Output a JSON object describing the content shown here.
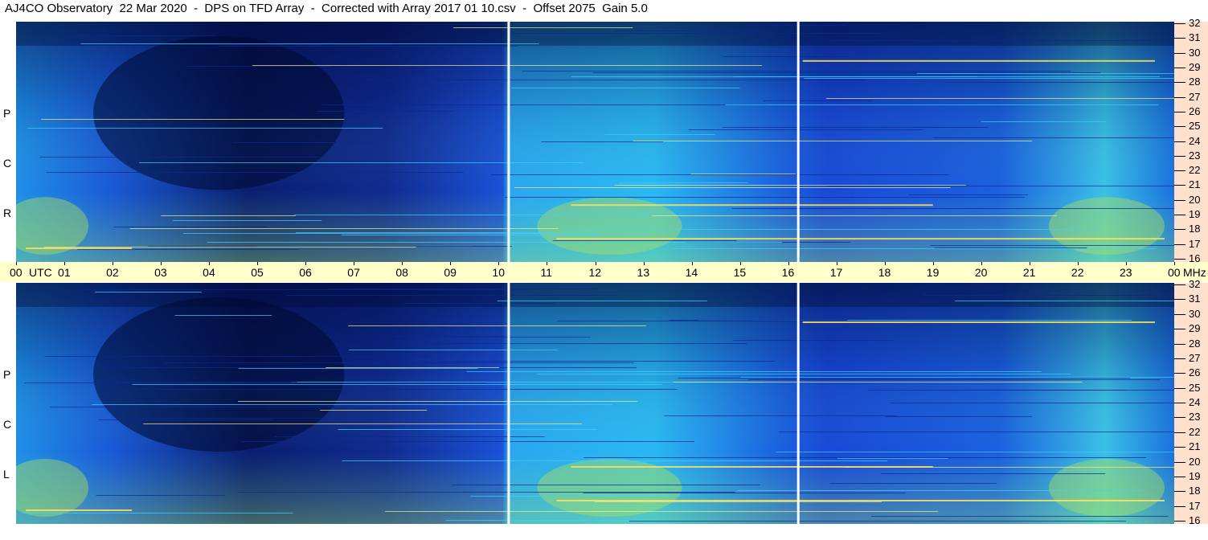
{
  "title": "AJ4CO Observatory  22 Mar 2020  -  DPS on TFD Array  -  Corrected with Array 2017 01 10.csv  -  Offset 2075  Gain 5.0",
  "panels": {
    "top": {
      "label_letters": [
        "P",
        "C",
        "R"
      ]
    },
    "bottom": {
      "label_letters": [
        "P",
        "C",
        "L"
      ]
    }
  },
  "time_axis": {
    "ticks": [
      "00",
      "01",
      "02",
      "03",
      "04",
      "05",
      "06",
      "07",
      "08",
      "09",
      "10",
      "11",
      "12",
      "13",
      "14",
      "15",
      "16",
      "17",
      "18",
      "19",
      "20",
      "21",
      "22",
      "23",
      "00"
    ],
    "unit_label": "UTC",
    "freq_unit_label": "MHz"
  },
  "freq_axis": {
    "ticks": [
      "32",
      "31",
      "30",
      "29",
      "28",
      "27",
      "26",
      "25",
      "24",
      "23",
      "22",
      "21",
      "20",
      "19",
      "18",
      "17",
      "16"
    ]
  },
  "colors": {
    "background_blue": "#1a4fe0",
    "dark_band": "#000a30",
    "bright_cyan": "#22b8ff",
    "green_yellow": "#a8e060",
    "time_axis_bg": "#ffffcc",
    "freq_axis_bg": "#ffe0cc"
  },
  "chart_data": {
    "type": "heatmap",
    "title": "AJ4CO Observatory  22 Mar 2020  -  DPS on TFD Array  -  Corrected with Array 2017 01 10.csv  -  Offset 2075  Gain 5.0",
    "panels": [
      "RCP",
      "LCP"
    ],
    "x": {
      "label": "UTC",
      "range": [
        "00",
        "00"
      ],
      "ticks": [
        "00",
        "01",
        "02",
        "03",
        "04",
        "05",
        "06",
        "07",
        "08",
        "09",
        "10",
        "11",
        "12",
        "13",
        "14",
        "15",
        "16",
        "17",
        "18",
        "19",
        "20",
        "21",
        "22",
        "23",
        "00"
      ]
    },
    "y": {
      "label": "MHz",
      "range": [
        16,
        32
      ],
      "ticks": [
        16,
        17,
        18,
        19,
        20,
        21,
        22,
        23,
        24,
        25,
        26,
        27,
        28,
        29,
        30,
        31,
        32
      ]
    },
    "data_gaps_utc": [
      10.2,
      16.2
    ]
  }
}
